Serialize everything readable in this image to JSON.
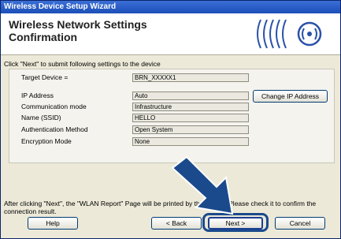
{
  "window": {
    "title": "Wireless Device Setup Wizard",
    "header_line1": "Wireless Network Settings",
    "header_line2": "Confirmation"
  },
  "intro_text": "Click \"Next\" to submit following settings to the device",
  "target_device": {
    "label": "Target Device =",
    "value": "BRN_XXXXX1"
  },
  "settings": [
    {
      "label": "IP Address",
      "value": "Auto"
    },
    {
      "label": "Communication mode",
      "value": "Infrastructure"
    },
    {
      "label": "Name (SSID)",
      "value": "HELLO"
    },
    {
      "label": "Authentication Method",
      "value": "Open System"
    },
    {
      "label": "Encryption Mode",
      "value": "None"
    }
  ],
  "buttons": {
    "change_ip": "Change IP Address",
    "help": "Help",
    "back": "< Back",
    "next": "Next >",
    "cancel": "Cancel"
  },
  "footer_text": "After clicking \"Next\", the \"WLAN Report\" Page will be printed by the device. Please check it to confirm the connection result.",
  "colors": {
    "titlebar": "#1c4fb8",
    "dialog_bg": "#ece9d8",
    "arrow": "#1a4a8c",
    "logo": "#2a52a8"
  }
}
